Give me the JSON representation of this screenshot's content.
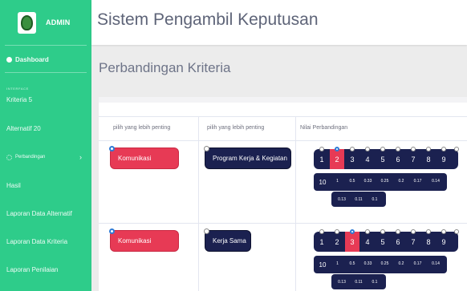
{
  "sidebar": {
    "brand_label": "ADMIN",
    "dashboard_label": "Dashboard",
    "section_label": "INTERFACE",
    "items": [
      {
        "label": "Kriteria 5"
      },
      {
        "label": "Alternatif 20"
      },
      {
        "label": "Perbandingan"
      },
      {
        "label": "Hasil"
      },
      {
        "label": "Laporan Data Alternatif"
      },
      {
        "label": "Laporan Data Kriteria"
      },
      {
        "label": "Laporan Penilaian"
      }
    ],
    "chevron": "›"
  },
  "header": {
    "title": "Sistem Pengambil Keputusan"
  },
  "page": {
    "title": "Perbandingan Kriteria"
  },
  "table": {
    "columns": [
      "pilih yang lebih penting",
      "pilih yang lebih penting",
      "Nilai Perbandingan"
    ],
    "rows": [
      {
        "left": "Komunikasi",
        "left_selected": true,
        "right": "Program Kerja & Kegiatan",
        "right_selected": false,
        "selected_value": "2"
      },
      {
        "left": "Komunikasi",
        "left_selected": true,
        "right": "Kerja Sama",
        "right_selected": false,
        "selected_value": "3"
      }
    ],
    "scale_values": [
      "1",
      "2",
      "3",
      "4",
      "5",
      "6",
      "7",
      "8",
      "9"
    ],
    "fraction_row1": [
      "10",
      "1",
      "0.5",
      "0.33",
      "0.25",
      "0.2",
      "0.17",
      "0.14"
    ],
    "fraction_row2": [
      "0.13",
      "0.11",
      "0.1"
    ]
  },
  "colors": {
    "sidebar": "#2ecc8a",
    "accent_red": "#e73a55",
    "navy": "#1b2150",
    "radio_checked": "#2f7bd6"
  },
  "icons": {
    "dashboard": "dashboard-icon",
    "perbandingan": "gear-icon",
    "logo": "logo-icon"
  }
}
